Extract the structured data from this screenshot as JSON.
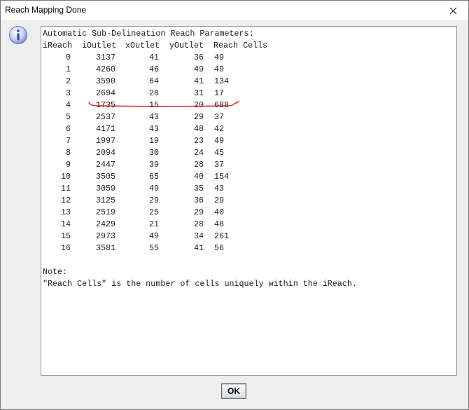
{
  "window": {
    "title": "Reach Mapping Done"
  },
  "report": {
    "header": "Automatic Sub-Delineation Reach Parameters:",
    "columns": [
      "iReach",
      "iOutlet",
      "xOutlet",
      "yOutlet",
      "Reach Cells"
    ],
    "rows": [
      [
        "0",
        "3137",
        "41",
        "36",
        "49"
      ],
      [
        "1",
        "4260",
        "46",
        "49",
        "49"
      ],
      [
        "2",
        "3590",
        "64",
        "41",
        "134"
      ],
      [
        "3",
        "2694",
        "28",
        "31",
        "17"
      ],
      [
        "4",
        "1735",
        "15",
        "20",
        "688"
      ],
      [
        "5",
        "2537",
        "43",
        "29",
        "37"
      ],
      [
        "6",
        "4171",
        "43",
        "48",
        "42"
      ],
      [
        "7",
        "1997",
        "19",
        "23",
        "49"
      ],
      [
        "8",
        "2094",
        "30",
        "24",
        "45"
      ],
      [
        "9",
        "2447",
        "39",
        "28",
        "37"
      ],
      [
        "10",
        "3505",
        "65",
        "40",
        "154"
      ],
      [
        "11",
        "3059",
        "49",
        "35",
        "43"
      ],
      [
        "12",
        "3125",
        "29",
        "36",
        "29"
      ],
      [
        "13",
        "2519",
        "25",
        "29",
        "40"
      ],
      [
        "14",
        "2429",
        "21",
        "28",
        "48"
      ],
      [
        "15",
        "2973",
        "49",
        "34",
        "261"
      ],
      [
        "16",
        "3581",
        "55",
        "41",
        "56"
      ]
    ],
    "note_label": "Note:",
    "note_text": "\"Reach Cells\" is the number of cells uniquely within the iReach.",
    "highlighted_row": "4",
    "highlight_color": "#e02020"
  },
  "buttons": {
    "ok_label": "OK"
  },
  "icons": {
    "dialog": "info-icon",
    "close": "close-icon"
  }
}
